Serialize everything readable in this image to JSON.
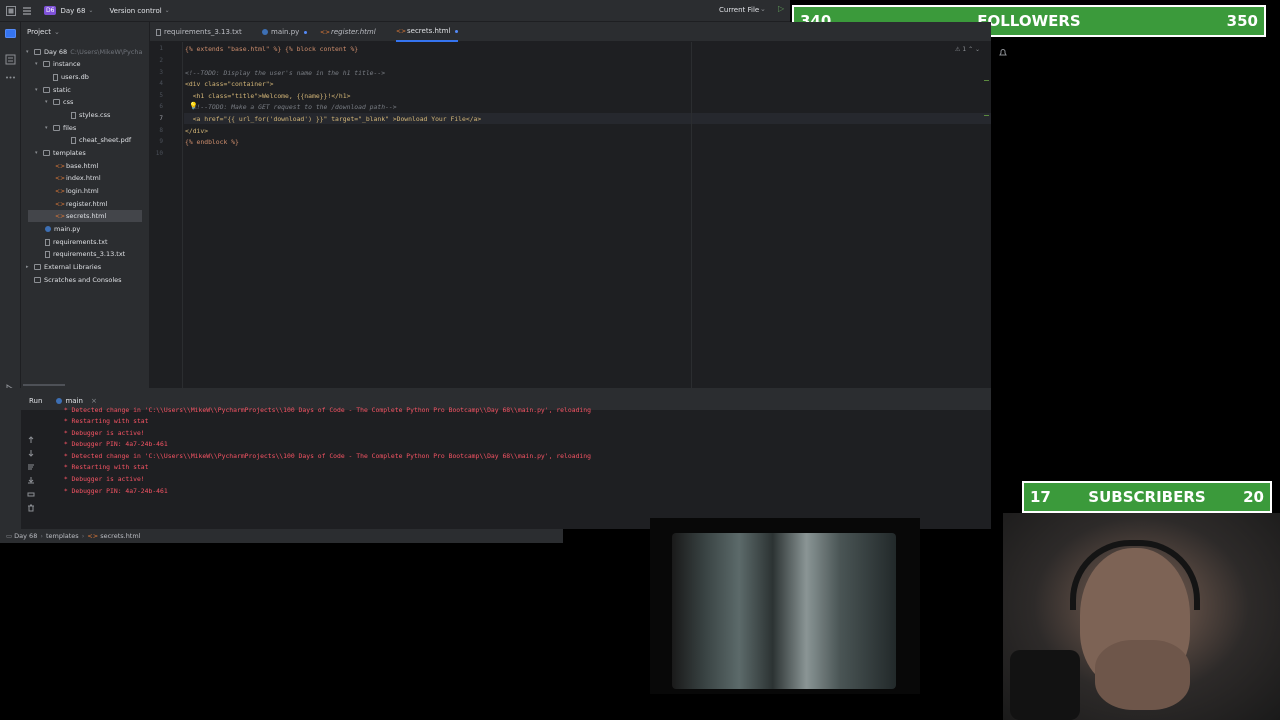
{
  "titlebar": {
    "project_badge": "D6",
    "project_name": "Day 68",
    "vcs": "Version control",
    "run_config": "Current File"
  },
  "overlays": {
    "followers": {
      "current": "340",
      "label": "FOLLOWERS",
      "goal": "350"
    },
    "subscribers": {
      "current": "17",
      "label": "SUBSCRIBERS",
      "goal": "20"
    }
  },
  "project_panel": {
    "title": "Project",
    "tree": [
      {
        "label": "Day 68",
        "hint": "C:\\Users\\MikeW\\Pycha",
        "type": "folder"
      },
      {
        "label": "instance",
        "type": "folder"
      },
      {
        "label": "users.db",
        "type": "file"
      },
      {
        "label": "static",
        "type": "folder"
      },
      {
        "label": "css",
        "type": "folder"
      },
      {
        "label": "styles.css",
        "type": "file"
      },
      {
        "label": "files",
        "type": "folder"
      },
      {
        "label": "cheat_sheet.pdf",
        "type": "file"
      },
      {
        "label": "templates",
        "type": "folder"
      },
      {
        "label": "base.html",
        "type": "html"
      },
      {
        "label": "index.html",
        "type": "html"
      },
      {
        "label": "login.html",
        "type": "html"
      },
      {
        "label": "register.html",
        "type": "html"
      },
      {
        "label": "secrets.html",
        "type": "html"
      },
      {
        "label": "main.py",
        "type": "py"
      },
      {
        "label": "requirements.txt",
        "type": "file"
      },
      {
        "label": "requirements_3.13.txt",
        "type": "file"
      },
      {
        "label": "External Libraries",
        "type": "folder"
      },
      {
        "label": "Scratches and Consoles",
        "type": "folder"
      }
    ]
  },
  "tabs": [
    {
      "label": "requirements_3.13.txt"
    },
    {
      "label": "main.py"
    },
    {
      "label": "register.html"
    },
    {
      "label": "secrets.html"
    }
  ],
  "editor": {
    "line_numbers": [
      "1",
      "2",
      "3",
      "4",
      "5",
      "6",
      "7",
      "8",
      "9",
      "10"
    ],
    "lines": {
      "l1": "{% extends \"base.html\" %} {% block content %}",
      "l3": "<!--TODO: Display the user's name in the h1 title-->",
      "l4": "<div class=\"container\">",
      "l5": "  <h1 class=\"title\">Welcome, {{name}}!</h1>",
      "l6": "  <!--TODO: Make a GET request to the /download path-->",
      "l7": "  <a href=\"{{ url_for('download') }}\" target=\"_blank\" >Download Your File</a>",
      "l8": "</div>",
      "l9": "{% endblock %}"
    },
    "inspection": "1"
  },
  "run": {
    "tab_label": "Run",
    "config": "main",
    "log": [
      " * Detected change in 'C:\\\\Users\\\\MikeW\\\\PycharmProjects\\\\100 Days of Code - The Complete Python Pro Bootcamp\\\\Day 68\\\\main.py', reloading",
      " * Restarting with stat",
      " * Debugger is active!",
      " * Debugger PIN: 4a7-24b-461",
      " * Detected change in 'C:\\\\Users\\\\MikeW\\\\PycharmProjects\\\\100 Days of Code - The Complete Python Pro Bootcamp\\\\Day 68\\\\main.py', reloading",
      " * Restarting with stat",
      " * Debugger is active!",
      " * Debugger PIN: 4a7-24b-461"
    ]
  },
  "statusbar": {
    "crumbs": [
      "Day 68",
      "templates",
      "secrets.html"
    ]
  },
  "colors": {
    "ide_bg": "#1e1f22",
    "panel_bg": "#2b2d30",
    "overlay_green": "#3b9a3b",
    "log_red": "#f75464"
  }
}
